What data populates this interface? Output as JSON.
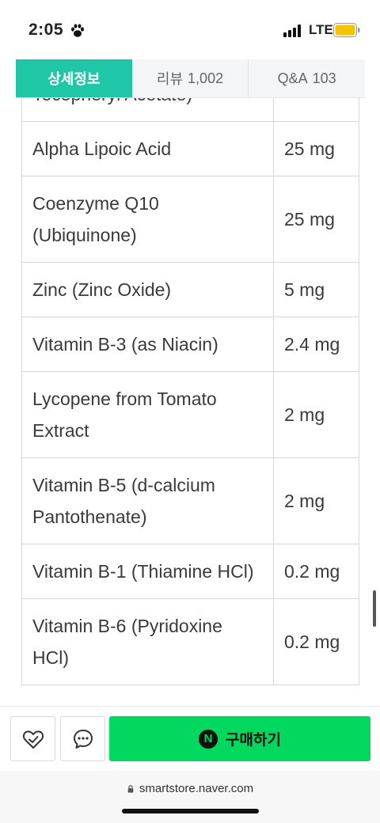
{
  "status_bar": {
    "time": "2:05",
    "network": "LTE"
  },
  "tabs": [
    {
      "label": "상세정보",
      "count": ""
    },
    {
      "label": "리뷰",
      "count": "1,002"
    },
    {
      "label": "Q&A",
      "count": "103"
    }
  ],
  "colors": {
    "tab_active": "#20c6a8",
    "buy_button": "#03d85e",
    "battery": "#f5c400"
  },
  "table": {
    "partial_top_row": {
      "name": "Tocopheryl Acetate)",
      "amount": ""
    },
    "rows": [
      {
        "name": "Alpha Lipoic Acid",
        "amount": "25 mg"
      },
      {
        "name": "Coenzyme Q10 (Ubiquinone)",
        "amount": "25 mg"
      },
      {
        "name": "Zinc (Zinc Oxide)",
        "amount": "5 mg"
      },
      {
        "name": "Vitamin B-3 (as Niacin)",
        "amount": "2.4 mg"
      },
      {
        "name": "Lycopene from Tomato Extract",
        "amount": "2 mg"
      },
      {
        "name": "Vitamin B-5 (d-calcium Pantothenate)",
        "amount": "2 mg"
      },
      {
        "name": "Vitamin B-1 (Thiamine HCl)",
        "amount": "0.2 mg"
      },
      {
        "name": "Vitamin B-6 (Pyridoxine HCl)",
        "amount": "0.2 mg"
      }
    ]
  },
  "actions": {
    "buy_label": "구매하기",
    "npay_letter": "N"
  },
  "browser": {
    "url": "smartstore.naver.com"
  }
}
